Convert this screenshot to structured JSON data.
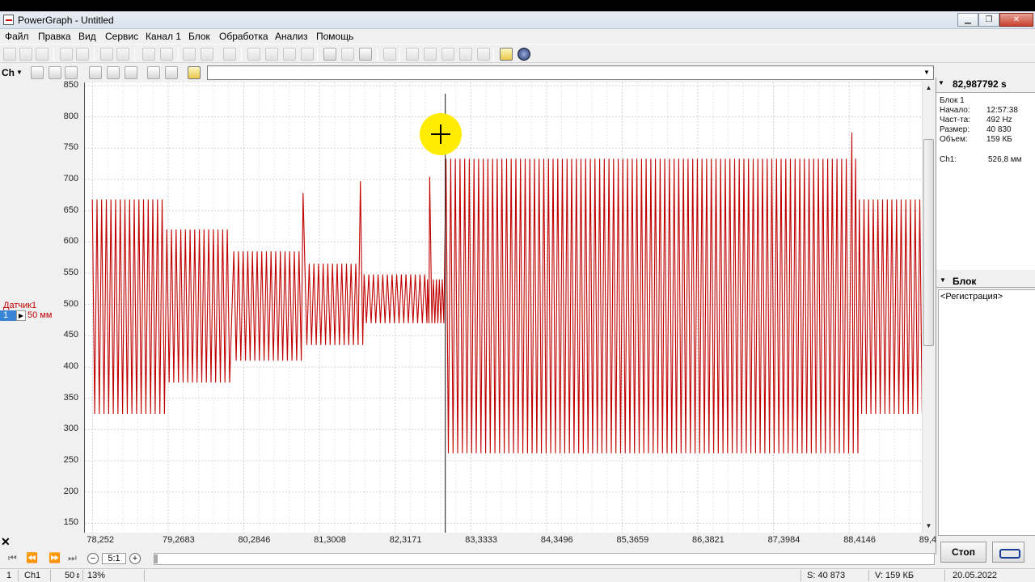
{
  "window": {
    "title": "PowerGraph - Untitled"
  },
  "menu": [
    "Файл",
    "Правка",
    "Вид",
    "Сервис",
    "Канал 1",
    "Блок",
    "Обработка",
    "Анализ",
    "Помощь"
  ],
  "toolbar2": {
    "channel_label": "Ch"
  },
  "sensor": {
    "name": "Датчик1",
    "index": "1",
    "scale": "50 мм"
  },
  "y_ticks": [
    "850",
    "800",
    "750",
    "700",
    "650",
    "600",
    "550",
    "500",
    "450",
    "400",
    "350",
    "300",
    "250",
    "200",
    "150"
  ],
  "x_ticks": [
    "78,252",
    "79,2683",
    "80,2846",
    "81,3008",
    "82,3171",
    "83,3333",
    "84,3496",
    "85,3659",
    "86,3821",
    "87,3984",
    "88,4146",
    "89,4"
  ],
  "zoom": {
    "ratio": "5:1"
  },
  "right_panel": {
    "time": "82,987792 s",
    "block": "Блок 1",
    "rows": [
      {
        "label": "Начало:",
        "value": "12:57:38"
      },
      {
        "label": "Част-та:",
        "value": "492 Hz"
      },
      {
        "label": "Размер:",
        "value": "40 830"
      },
      {
        "label": "Объем:",
        "value": "159 КБ"
      }
    ],
    "channel": {
      "label": "Ch1:",
      "value": "526,8 мм"
    },
    "blok_header": "Блок",
    "blok_items": [
      "<Регистрация>"
    ]
  },
  "buttons": {
    "stop": "Стоп"
  },
  "status": {
    "index": "1",
    "channel": "Ch1",
    "fifty": "50",
    "percent": "13%",
    "samples": "S: 40 873",
    "volume": "V: 159 КБ",
    "date": "20.05.2022"
  },
  "chart_data": {
    "type": "line",
    "xlabel": "",
    "ylabel": "",
    "xlim": [
      78.15,
      89.4
    ],
    "ylim": [
      135,
      855
    ],
    "grid": true,
    "color": "#c00000",
    "cursor_x": 82.99,
    "segments": [
      {
        "x_start": 78.25,
        "x_end": 79.25,
        "low": 325,
        "high": 668,
        "period": 0.0625
      },
      {
        "x_start": 79.25,
        "x_end": 80.15,
        "low": 375,
        "high": 620,
        "period": 0.0625
      },
      {
        "x_start": 80.15,
        "x_end": 81.1,
        "low": 410,
        "high": 585,
        "period": 0.0625
      },
      {
        "x_start": 81.1,
        "x_end": 81.9,
        "low": 435,
        "high": 565,
        "period": 0.0625
      },
      {
        "x_start": 81.9,
        "x_end": 82.75,
        "low": 470,
        "high": 548,
        "period": 0.0625
      },
      {
        "x_start": 82.75,
        "x_end": 83.0,
        "low": 470,
        "high": 540,
        "period": 0.04
      },
      {
        "x_start": 83.0,
        "x_end": 88.55,
        "low": 262,
        "high": 733,
        "period": 0.0625
      },
      {
        "x_start": 88.55,
        "x_end": 89.4,
        "low": 325,
        "high": 668,
        "period": 0.0625
      }
    ],
    "spikes": [
      {
        "x": 81.08,
        "y": 678
      },
      {
        "x": 81.85,
        "y": 697
      },
      {
        "x": 82.78,
        "y": 704
      },
      {
        "x": 88.45,
        "y": 775
      }
    ]
  }
}
